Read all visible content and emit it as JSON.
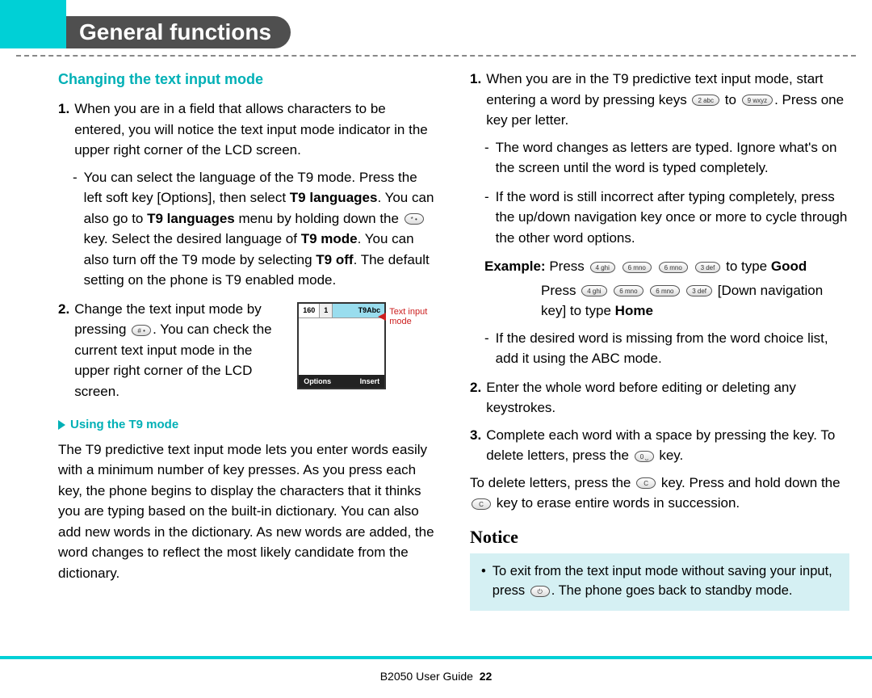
{
  "header": {
    "title": "General functions"
  },
  "left": {
    "h1": "Changing the text input mode",
    "item1_n": "1.",
    "item1_a": "When you are in a field that allows characters to be entered, you will notice the text input mode indicator in the upper right corner of the LCD screen.",
    "item1_b_pre": "You can select the language of the T9 mode. Press the left soft key [Options], then select ",
    "item1_b_bold1": "T9 languages",
    "item1_b_mid1": ". You can also go to ",
    "item1_b_bold2": "T9 languages",
    "item1_b_mid2": " menu by holding down the ",
    "item1_b_mid3": " key. Select the desired language of ",
    "item1_b_bold3": "T9 mode",
    "item1_b_mid4": ". You can also turn off the T9 mode by selecting ",
    "item1_b_bold4": "T9 off",
    "item1_b_end": ". The default setting on the phone is T9 enabled mode.",
    "item2_n": "2.",
    "item2_a": "Change the text input mode by pressing ",
    "item2_b": ". You can check the current text input mode in the upper right corner of the LCD screen.",
    "mini": {
      "count": "160",
      "idx": "1",
      "mode": "T9Abc",
      "opt": "Options",
      "ins": "Insert",
      "label1": "Text input",
      "label2": "mode"
    },
    "h2": "Using the T9 mode",
    "t9para": "The T9 predictive text input mode lets you enter words easily with a minimum number of key presses. As you press each key, the phone begins to display the characters that it thinks you are typing based on the built-in dictionary. You can also add new words in the dictionary. As new words are added, the word changes to reflect the most likely candidate from the dictionary."
  },
  "right": {
    "r1_n": "1.",
    "r1_a": "When you are in the T9 predictive text input mode, start entering a word by pressing keys ",
    "r1_b": " to ",
    "r1_c": ". Press one key per letter.",
    "r1_dash1": "The word changes as letters are typed. Ignore what's on the screen until the word is typed completely.",
    "r1_dash2": "If the word is still incorrect after typing completely, press the up/down navigation key once or more to cycle through the other word options.",
    "ex_label": "Example:",
    "ex_press": "Press",
    "ex_totype": " to type ",
    "ex_good": "Good",
    "ex_down": " [Down navigation key] to type ",
    "ex_home": "Home",
    "r1_dash3": "If the desired word is missing from the word choice list, add it using the ABC mode.",
    "r2_n": "2.",
    "r2": "Enter the whole word before editing or deleting any keystrokes.",
    "r3_n": "3.",
    "r3_a": "Complete each word with a space by pressing the key. To delete letters, press the ",
    "r3_b": " key.",
    "del_a": "To delete letters, press the ",
    "del_b": " key. Press and hold down the ",
    "del_c": " key to erase entire words in succession.",
    "notice_h": "Notice",
    "notice_a": "To exit from the text input mode without saving your input, press ",
    "notice_b": ". The phone goes back to standby mode."
  },
  "keys": {
    "star": "* •",
    "hash": "# •",
    "k2": "2 abc",
    "k9": "9 wxyz",
    "k4": "4 ghi",
    "k6": "6 mno",
    "k3": "3 def",
    "k0": "0 ⎵",
    "c": "C",
    "end": "⏻"
  },
  "footer": {
    "guide": "B2050 User Guide",
    "page": "22"
  }
}
